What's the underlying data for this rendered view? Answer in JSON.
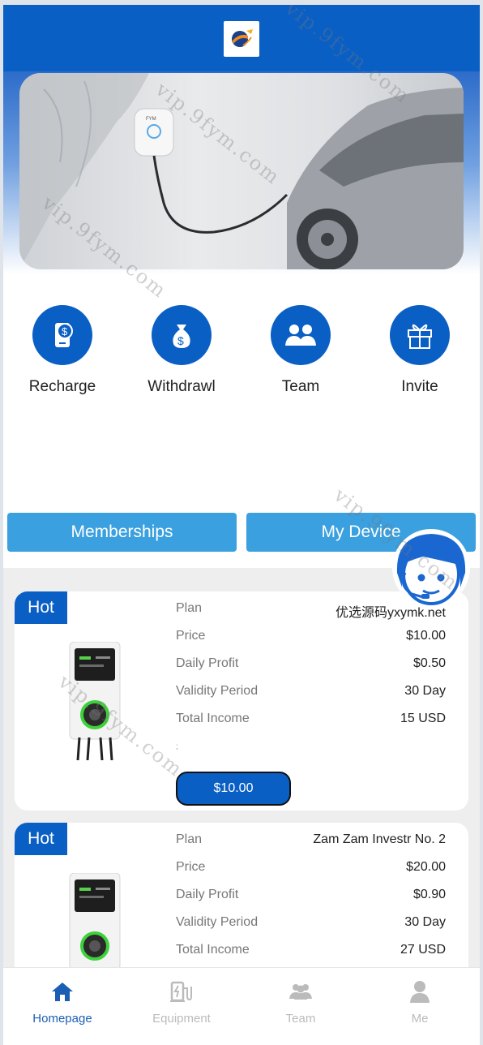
{
  "header": {
    "logo_icon": "solar-globe-logo"
  },
  "banner": {
    "image": "ev-charger-wall-car-photo",
    "charger_brand": "FYM"
  },
  "shortcuts": [
    {
      "label": "Recharge",
      "icon": "phone-dollar-icon"
    },
    {
      "label": "Withdrawl",
      "icon": "money-bag-icon"
    },
    {
      "label": "Team",
      "icon": "team-icon"
    },
    {
      "label": "Invite",
      "icon": "gift-icon"
    }
  ],
  "tabs": {
    "memberships": "Memberships",
    "my_device": "My Device"
  },
  "cards": [
    {
      "badge": "Hot",
      "rows": [
        {
          "k": "Plan",
          "v": "优选源码yxymk.net"
        },
        {
          "k": "Price",
          "v": "$10.00"
        },
        {
          "k": "Daily Profit",
          "v": "$0.50"
        },
        {
          "k": "Validity Period",
          "v": "30 Day"
        },
        {
          "k": "Total Income",
          "v": "15 USD"
        }
      ],
      "note": ";",
      "button": "$10.00"
    },
    {
      "badge": "Hot",
      "rows": [
        {
          "k": "Plan",
          "v": "Zam Zam Investr No. 2"
        },
        {
          "k": "Price",
          "v": "$20.00"
        },
        {
          "k": "Daily Profit",
          "v": "$0.90"
        },
        {
          "k": "Validity Period",
          "v": "30 Day"
        },
        {
          "k": "Total Income",
          "v": "27 USD"
        }
      ]
    }
  ],
  "bottom_nav": [
    {
      "label": "Homepage",
      "icon": "home-icon",
      "active": true
    },
    {
      "label": "Equipment",
      "icon": "charging-station-icon",
      "active": false
    },
    {
      "label": "Team",
      "icon": "team-icon",
      "active": false
    },
    {
      "label": "Me",
      "icon": "person-icon",
      "active": false
    }
  ],
  "watermark": "vip.9fym.com",
  "colors": {
    "primary": "#0a5fc4",
    "tab": "#3aa0df",
    "nav_active": "#1a5fb4",
    "nav_inactive": "#bbbbbb"
  }
}
